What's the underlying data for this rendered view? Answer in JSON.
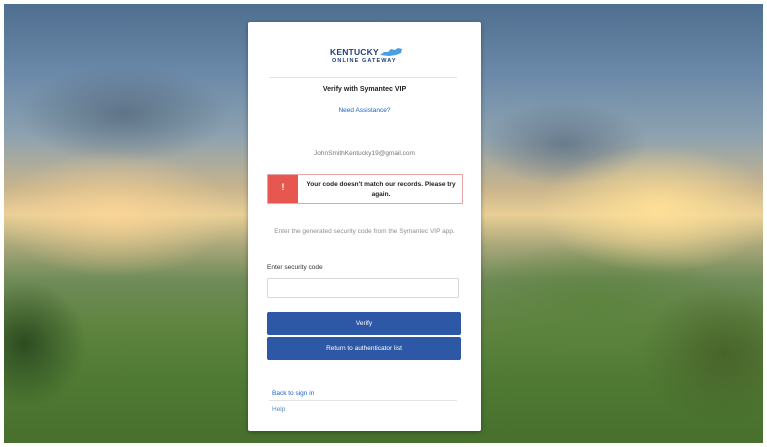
{
  "logo": {
    "name": "KENTUCKY",
    "subtitle": "ONLINE GATEWAY",
    "icon": "kentucky-state-shape-icon",
    "color": "#1f3f7a",
    "accent": "#4a9fe0"
  },
  "title": "Verify with Symantec VIP",
  "assistance_link": "Need Assistance?",
  "email": "JohnSmithKentucky19@gmail.com",
  "error": {
    "icon": "!",
    "message": "Your code doesn't match our records. Please try again.",
    "color": "#e5574f"
  },
  "instructions": "Enter the generated security code from the Symantec VIP app.",
  "security_code": {
    "label": "Enter security code",
    "value": ""
  },
  "buttons": {
    "verify": "Verify",
    "return": "Return to authenticator list",
    "color": "#2c58a6"
  },
  "links": {
    "back": "Back to sign in",
    "help": "Help"
  }
}
